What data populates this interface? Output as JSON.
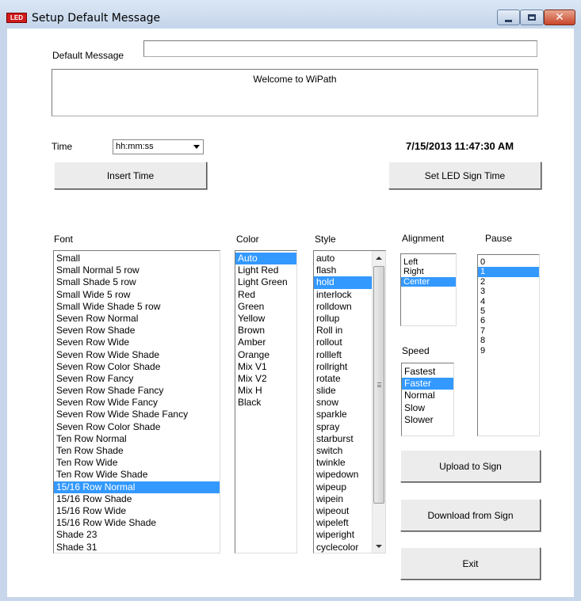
{
  "window": {
    "icon_text": "LED",
    "title": "Setup Default Message",
    "minimize_label": "",
    "close_label": "✕"
  },
  "default_message": {
    "label": "Default Message",
    "value": "",
    "text": "Welcome to WiPath"
  },
  "time": {
    "label": "Time",
    "format_selected": "hh:mm:ss",
    "current_datetime": "7/15/2013 11:47:30 AM",
    "insert_button": "Insert Time",
    "set_sign_time_button": "Set LED Sign Time"
  },
  "font": {
    "label": "Font",
    "items": [
      "Small",
      "Small Normal 5 row",
      "Small Shade 5 row",
      "Small Wide 5 row",
      "Small Wide Shade 5 row",
      "Seven Row Normal",
      "Seven Row Shade",
      "Seven Row Wide",
      "Seven Row Wide Shade",
      "Seven Row Color Shade",
      "Seven Row Fancy",
      "Seven Row Shade Fancy",
      "Seven Row Wide Fancy",
      "Seven Row Wide Shade Fancy",
      "Seven Row Color Shade",
      "Ten Row Normal",
      "Ten Row Shade",
      "Ten Row Wide",
      "Ten Row Wide Shade",
      "15/16 Row Normal",
      "15/16 Row Shade",
      "15/16 Row Wide",
      "15/16 Row Wide Shade",
      "Shade 23",
      "Shade 31"
    ],
    "selected": 19
  },
  "color": {
    "label": "Color",
    "items": [
      "Auto",
      "Light Red",
      "Light Green",
      "Red",
      "Green",
      "Yellow",
      "Brown",
      "Amber",
      "Orange",
      "Mix V1",
      "Mix V2",
      "Mix H",
      "Black"
    ],
    "selected": 0
  },
  "style": {
    "label": "Style",
    "items": [
      "auto",
      "flash",
      "hold",
      "interlock",
      "rolldown",
      "rollup",
      "Roll in",
      "rollout",
      "rollleft",
      "rollright",
      "rotate",
      "slide",
      "snow",
      "sparkle",
      "spray",
      "starburst",
      "switch",
      "twinkle",
      "wipedown",
      "wipeup",
      "wipein",
      "wipeout",
      "wipeleft",
      "wiperight",
      "cyclecolor"
    ],
    "selected": 2
  },
  "alignment": {
    "label": "Alignment",
    "items": [
      "Left",
      "Right",
      "Center"
    ],
    "selected": 2
  },
  "speed": {
    "label": "Speed",
    "items": [
      "Fastest",
      "Faster",
      "Normal",
      "Slow",
      "Slower"
    ],
    "selected": 1
  },
  "pause": {
    "label": "Pause",
    "items": [
      "0",
      "1",
      "2",
      "3",
      "4",
      "5",
      "6",
      "7",
      "8",
      "9"
    ],
    "selected": 1
  },
  "actions": {
    "upload": "Upload to Sign",
    "download": "Download from Sign",
    "exit": "Exit"
  },
  "colors": {
    "selection": "#3399ff",
    "window_frame": "#c7d6ea",
    "close_button": "#c8452a"
  }
}
